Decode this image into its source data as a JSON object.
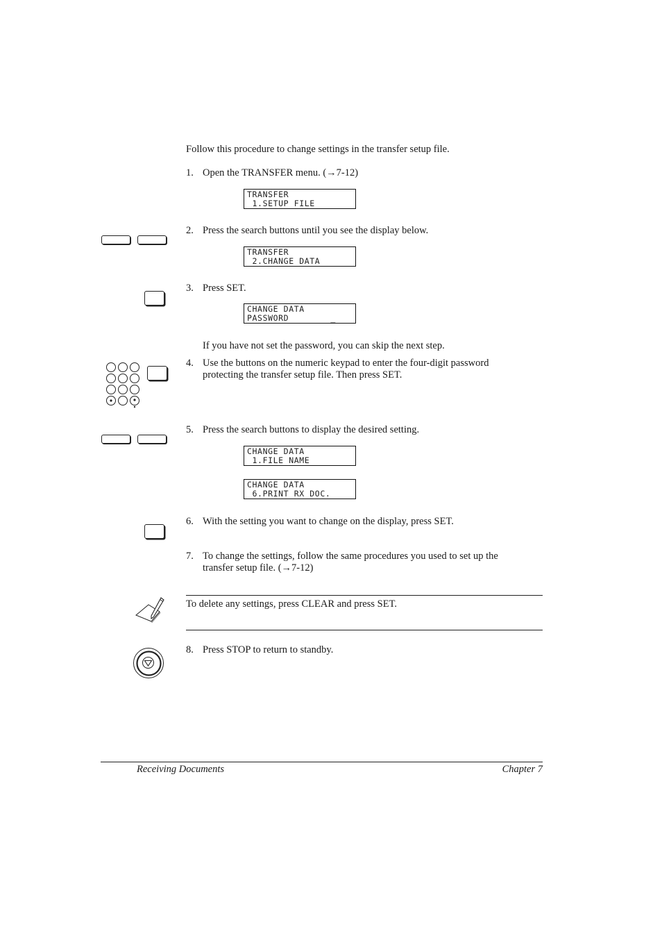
{
  "intro": "Follow this procedure to change settings in the transfer setup file.",
  "steps": [
    {
      "num": "1.",
      "text": "Open the TRANSFER menu. (→7-12)"
    },
    {
      "num": "2.",
      "text": "Press the search buttons until you see the display below."
    },
    {
      "num": "3.",
      "text": "Press SET."
    },
    {
      "num": "4.",
      "line1": "Use the buttons on the numeric keypad to enter the four-digit password",
      "line2": "protecting the transfer setup file. Then press SET."
    },
    {
      "num": "5.",
      "text": "Press the search buttons to display the desired setting."
    },
    {
      "num": "6.",
      "text": "With the setting you want to change on the display, press SET."
    },
    {
      "num": "7.",
      "line1": "To change the settings, follow the same procedures you used to set up the",
      "line2": "transfer setup file. (→7-12)"
    },
    {
      "num": "8.",
      "text": "Press STOP to return to standby."
    }
  ],
  "skip_note": "If you have not set the password, you can skip the next step.",
  "displays": {
    "d1": {
      "line1": "TRANSFER",
      "line2": " 1.SETUP FILE"
    },
    "d2": {
      "line1": "TRANSFER",
      "line2": " 2.CHANGE DATA"
    },
    "d3": {
      "line1": "CHANGE DATA",
      "line2": "PASSWORD        _"
    },
    "d4": {
      "line1": "CHANGE DATA",
      "line2": " 1.FILE NAME"
    },
    "d5": {
      "line1": "CHANGE DATA",
      "line2": " 6.PRINT RX DOC."
    }
  },
  "note": "To delete any settings, press CLEAR and press SET.",
  "footer": {
    "left": "Receiving Documents",
    "right": "Chapter 7"
  },
  "icons": {
    "search_buttons": "search-buttons-icon",
    "set_button": "set-button-icon",
    "keypad": "numeric-keypad-icon",
    "note": "note-pencil-icon",
    "stop": "stop-button-icon"
  }
}
